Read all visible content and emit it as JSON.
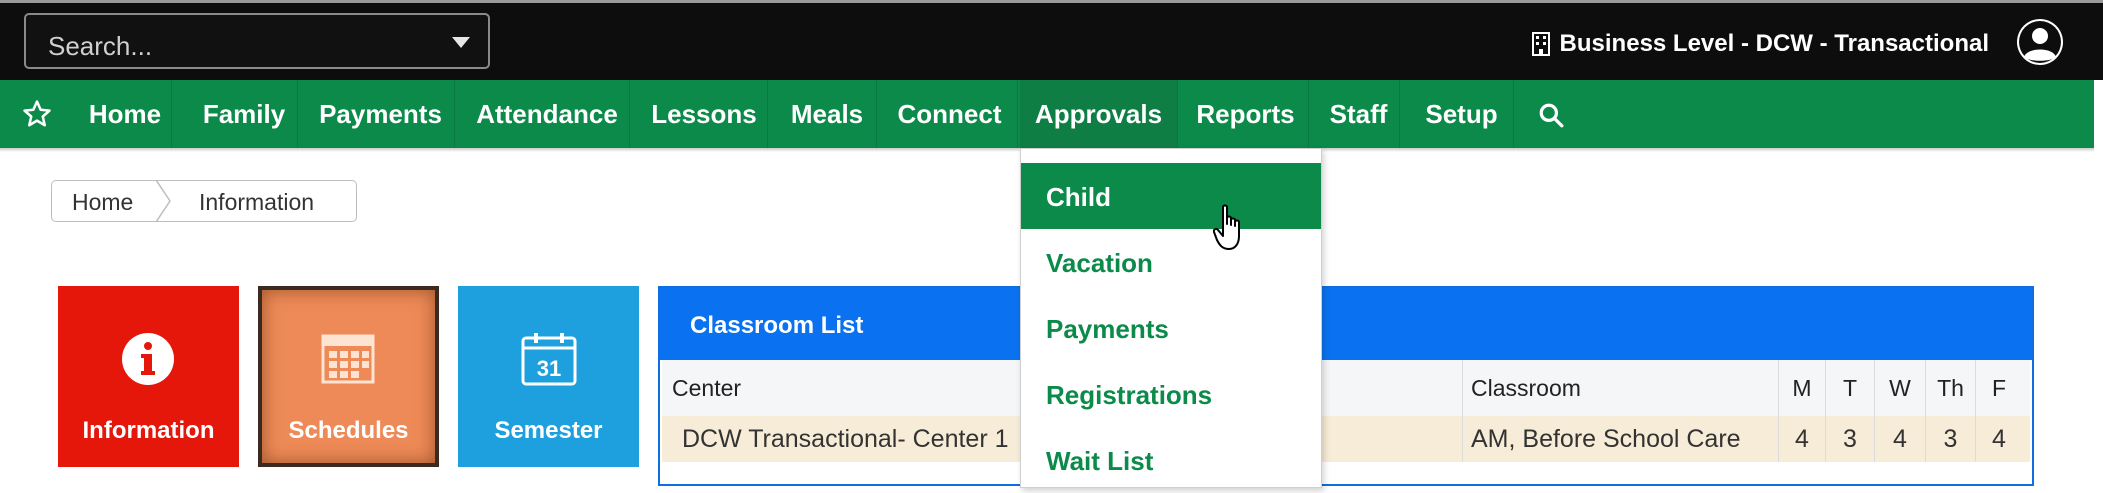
{
  "topbar": {
    "search_placeholder": "Search...",
    "business_level": "Business Level - DCW - Transactional",
    "building_icon": "building-icon",
    "avatar_icon": "user-avatar-icon"
  },
  "nav": {
    "items": [
      "Home",
      "Family",
      "Payments",
      "Attendance",
      "Lessons",
      "Meals",
      "Connect",
      "Approvals",
      "Reports",
      "Staff",
      "Setup"
    ],
    "active": "Approvals",
    "color": "#0b8a4a"
  },
  "dropdown": {
    "items": [
      "Child",
      "Vacation",
      "Payments",
      "Registrations",
      "Wait List"
    ],
    "highlighted": "Child"
  },
  "breadcrumb": [
    "Home",
    "Information"
  ],
  "tiles": [
    {
      "label": "Information",
      "color": "#e4170a",
      "icon": "info-icon"
    },
    {
      "label": "Schedules",
      "color": "#ee8a57",
      "icon": "calendar-grid-icon"
    },
    {
      "label": "Semester",
      "color": "#1fa0de",
      "icon": "calendar-31-icon",
      "icon_text": "31"
    }
  ],
  "classroom": {
    "title": "Classroom List",
    "headers": {
      "center": "Center",
      "classroom": "Classroom",
      "m": "M",
      "t": "T",
      "w": "W",
      "th": "Th",
      "f": "F"
    },
    "row": {
      "center": "DCW Transactional- Center 1",
      "classroom": "AM, Before School Care",
      "m": "4",
      "t": "3",
      "w": "4",
      "th": "3",
      "f": "4"
    }
  }
}
